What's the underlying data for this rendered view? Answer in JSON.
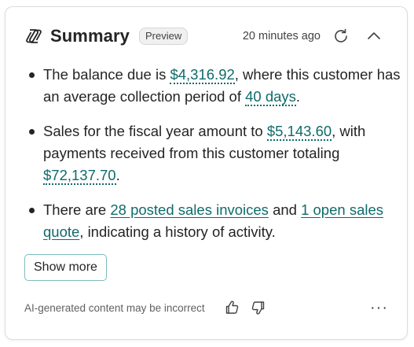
{
  "header": {
    "title": "Summary",
    "badge": "Preview",
    "timestamp": "20 minutes ago"
  },
  "bullets": [
    {
      "t1": "The balance due is ",
      "v1": "$4,316.92",
      "t2": ", where this customer has an average collection period of ",
      "v2": "40 days",
      "t3": "."
    },
    {
      "t1": "Sales for the fiscal year amount to ",
      "v1": "$5,143.60",
      "t2": ", with payments received from this customer totaling ",
      "v2": "$72,137.70",
      "t3": "."
    },
    {
      "t1": "There are ",
      "v1": "28 posted sales invoices",
      "t2": " and ",
      "v2": "1 open sales quote",
      "t3": ", indicating a history of activity."
    }
  ],
  "actions": {
    "show_more": "Show more"
  },
  "footer": {
    "disclaimer": "AI-generated content may be incorrect",
    "more": "···"
  },
  "colors": {
    "link": "#0f6b6b",
    "button_border": "#7fbdbd"
  },
  "icons": {
    "logo": "copilot-logo-icon",
    "refresh": "refresh-icon",
    "collapse": "chevron-up-icon",
    "like": "thumbs-up-icon",
    "dislike": "thumbs-down-icon",
    "more": "more-options-icon"
  }
}
